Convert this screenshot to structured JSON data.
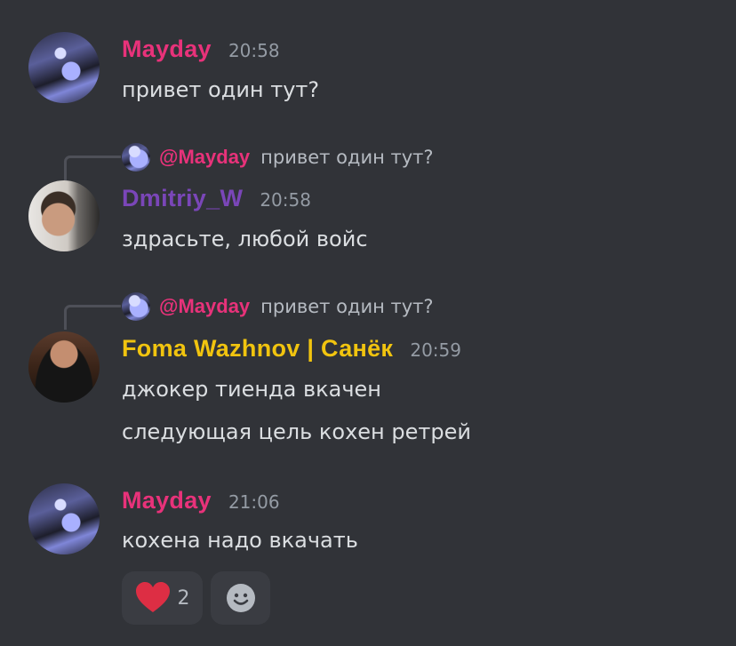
{
  "colors": {
    "background": "#313338",
    "mayday": "#e8327a",
    "dmitriy": "#7a46b8",
    "foma": "#f1c40f",
    "timestamp": "#949ba4",
    "text": "#dbdee1"
  },
  "messages": [
    {
      "author": "Mayday",
      "time": "20:58",
      "lines": [
        "привет один тут?"
      ],
      "avatar": "mayday-avatar"
    },
    {
      "reply_to": {
        "author": "@Mayday",
        "text": "привет один тут?"
      },
      "author": "Dmitriy_W",
      "time": "20:58",
      "lines": [
        "здрасьте, любой войс"
      ],
      "avatar": "dmitriy-avatar"
    },
    {
      "reply_to": {
        "author": "@Mayday",
        "text": "привет один тут?"
      },
      "author": "Foma Wazhnov | Санёк",
      "time": "20:59",
      "lines": [
        "джокер тиенда вкачен",
        "следующая цель кохен ретрей"
      ],
      "avatar": "foma-avatar"
    },
    {
      "author": "Mayday",
      "time": "21:06",
      "lines": [
        "кохена надо вкачать"
      ],
      "avatar": "mayday-avatar"
    }
  ],
  "reactions": [
    {
      "emoji": "red-heart-icon",
      "count": "2"
    },
    {
      "emoji": "add-reaction-icon"
    }
  ]
}
